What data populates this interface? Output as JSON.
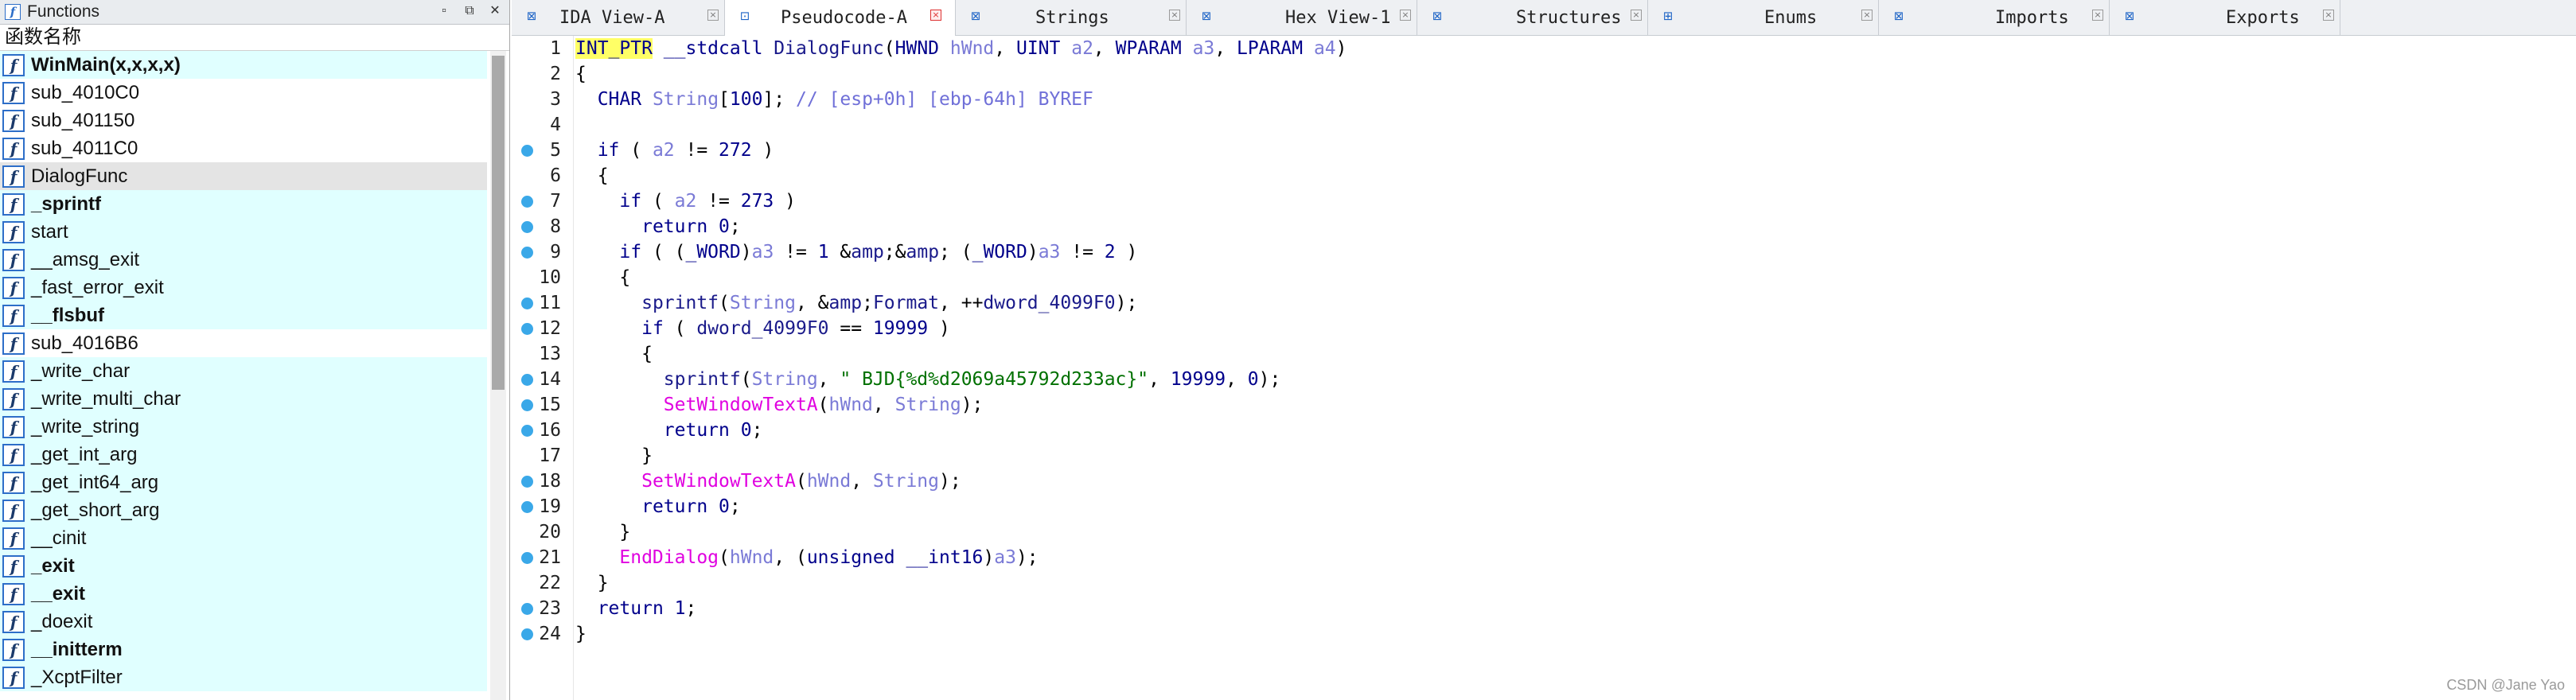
{
  "functions_panel": {
    "title": "Functions",
    "column_header": "函数名称",
    "items": [
      {
        "name": "WinMain(x,x,x,x)",
        "bold": true,
        "style": "lib"
      },
      {
        "name": "sub_4010C0",
        "bold": false,
        "style": "plain"
      },
      {
        "name": "sub_401150",
        "bold": false,
        "style": "plain"
      },
      {
        "name": "sub_4011C0",
        "bold": false,
        "style": "plain"
      },
      {
        "name": "DialogFunc",
        "bold": false,
        "style": "selected"
      },
      {
        "name": "_sprintf",
        "bold": true,
        "style": "lib"
      },
      {
        "name": "start",
        "bold": false,
        "style": "lib"
      },
      {
        "name": "__amsg_exit",
        "bold": false,
        "style": "lib"
      },
      {
        "name": "_fast_error_exit",
        "bold": false,
        "style": "lib"
      },
      {
        "name": "__flsbuf",
        "bold": true,
        "style": "lib"
      },
      {
        "name": "sub_4016B6",
        "bold": false,
        "style": "plain"
      },
      {
        "name": "_write_char",
        "bold": false,
        "style": "lib"
      },
      {
        "name": "_write_multi_char",
        "bold": false,
        "style": "lib"
      },
      {
        "name": "_write_string",
        "bold": false,
        "style": "lib"
      },
      {
        "name": "_get_int_arg",
        "bold": false,
        "style": "lib"
      },
      {
        "name": "_get_int64_arg",
        "bold": false,
        "style": "lib"
      },
      {
        "name": "_get_short_arg",
        "bold": false,
        "style": "lib"
      },
      {
        "name": "__cinit",
        "bold": false,
        "style": "lib"
      },
      {
        "name": "_exit",
        "bold": true,
        "style": "lib"
      },
      {
        "name": "__exit",
        "bold": true,
        "style": "lib"
      },
      {
        "name": "_doexit",
        "bold": false,
        "style": "lib"
      },
      {
        "name": "__initterm",
        "bold": true,
        "style": "lib"
      },
      {
        "name": "_XcptFilter",
        "bold": false,
        "style": "lib"
      }
    ]
  },
  "tabs": [
    {
      "label": "IDA View-A",
      "icon": "ida-view-icon",
      "active": false
    },
    {
      "label": "Pseudocode-A",
      "icon": "pseudocode-icon",
      "active": true
    },
    {
      "label": "Strings",
      "icon": "strings-icon",
      "active": false
    },
    {
      "label": "Hex View-1",
      "icon": "hex-view-icon",
      "active": false
    },
    {
      "label": "Structures",
      "icon": "structures-icon",
      "active": false
    },
    {
      "label": "Enums",
      "icon": "enums-icon",
      "active": false
    },
    {
      "label": "Imports",
      "icon": "imports-icon",
      "active": false
    },
    {
      "label": "Exports",
      "icon": "exports-icon",
      "active": false
    }
  ],
  "code": {
    "lines": [
      {
        "n": "1",
        "bp": false,
        "text": "INT_PTR __stdcall DialogFunc(HWND hWnd, UINT a2, WPARAM a3, LPARAM a4)"
      },
      {
        "n": "2",
        "bp": false,
        "text": "{"
      },
      {
        "n": "3",
        "bp": false,
        "text": "  CHAR String[100]; // [esp+0h] [ebp-64h] BYREF"
      },
      {
        "n": "4",
        "bp": false,
        "text": ""
      },
      {
        "n": "5",
        "bp": true,
        "text": "  if ( a2 != 272 )"
      },
      {
        "n": "6",
        "bp": false,
        "text": "  {"
      },
      {
        "n": "7",
        "bp": true,
        "text": "    if ( a2 != 273 )"
      },
      {
        "n": "8",
        "bp": true,
        "text": "      return 0;"
      },
      {
        "n": "9",
        "bp": true,
        "text": "    if ( (_WORD)a3 != 1 && (_WORD)a3 != 2 )"
      },
      {
        "n": "10",
        "bp": false,
        "text": "    {"
      },
      {
        "n": "11",
        "bp": true,
        "text": "      sprintf(String, &Format, ++dword_4099F0);"
      },
      {
        "n": "12",
        "bp": true,
        "text": "      if ( dword_4099F0 == 19999 )"
      },
      {
        "n": "13",
        "bp": false,
        "text": "      {"
      },
      {
        "n": "14",
        "bp": true,
        "text": "        sprintf(String, \" BJD{%d%d2069a45792d233ac}\", 19999, 0);"
      },
      {
        "n": "15",
        "bp": true,
        "text": "        SetWindowTextA(hWnd, String);"
      },
      {
        "n": "16",
        "bp": true,
        "text": "        return 0;"
      },
      {
        "n": "17",
        "bp": false,
        "text": "      }"
      },
      {
        "n": "18",
        "bp": true,
        "text": "      SetWindowTextA(hWnd, String);"
      },
      {
        "n": "19",
        "bp": true,
        "text": "      return 0;"
      },
      {
        "n": "20",
        "bp": false,
        "text": "    }"
      },
      {
        "n": "21",
        "bp": true,
        "text": "    EndDialog(hWnd, (unsigned __int16)a3);"
      },
      {
        "n": "22",
        "bp": false,
        "text": "  }"
      },
      {
        "n": "23",
        "bp": true,
        "text": "  return 1;"
      },
      {
        "n": "24",
        "bp": true,
        "text": "}"
      }
    ]
  },
  "watermark": "CSDN @Jane Yao",
  "colors": {
    "lib_function_bg": "#e0ffff",
    "selected_function_bg": "#e4e4e4",
    "breakpoint_dot": "#3aa8e8",
    "api_call": "#e000e0",
    "string_literal": "#007000",
    "keyword": "#00008b",
    "variable": "#7a7ad6",
    "cursor_highlight": "#ffff66"
  }
}
